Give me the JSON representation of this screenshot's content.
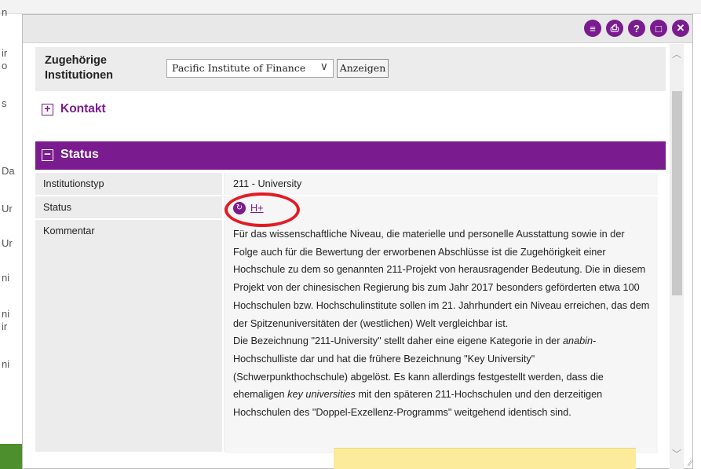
{
  "background": {
    "left_letters": [
      "n",
      "ir",
      "o",
      "s",
      "Da",
      "Ur",
      "Ur",
      "ni",
      "ni",
      "ir",
      "ni"
    ],
    "right_links": [
      "n",
      "it"
    ]
  },
  "titlebar": {
    "icons": [
      "list-icon",
      "print-icon",
      "help-icon",
      "maximize-icon",
      "close-icon"
    ],
    "accent": "#7a1b8f"
  },
  "institutions": {
    "label": "Zugehörige Institutionen",
    "selected": "Pacific Institute of Finance",
    "button": "Anzeigen"
  },
  "kontakt": {
    "toggle": "+",
    "label": "Kontakt"
  },
  "status_section": {
    "toggle": "−",
    "label": "Status"
  },
  "rows": [
    {
      "key": "Institutionstyp",
      "value": "211 - University"
    },
    {
      "key": "Status",
      "value": "H+"
    },
    {
      "key": "Kommentar"
    }
  ],
  "comment": {
    "p1": "Für das wissenschaftliche Niveau, die materielle und personelle Ausstattung sowie in der Folge auch für die Bewertung der erworbenen Abschlüsse ist die Zugehörigkeit einer Hochschule zu dem so genannten 211-Projekt von herausragender Bedeutung. Die in diesem Projekt von der chinesischen Regierung bis zum Jahr 2017 besonders geförderten etwa 100 Hochschulen bzw. Hochschulinstitute sollen im 21. Jahrhundert ein Niveau erreichen, das dem der Spitzenuniversitäten der (westlichen) Welt vergleichbar ist.",
    "p2a": "Die Bezeichnung \"211-University\" stellt daher eine eigene Kategorie in der ",
    "p2b": "anabin",
    "p2c": "-Hochschulliste dar und hat die frühere Bezeichnung \"Key University\" (Schwerpunkthochschule) abgelöst. Es kann allerdings festgestellt werden, dass die ehemaligen ",
    "p2d": "key universities",
    "p2e": " mit den späteren 211-Hochschulen und den derzeitigen Hochschulen des \"Doppel-Exzellenz-Programms\" weitgehend identisch sind."
  }
}
